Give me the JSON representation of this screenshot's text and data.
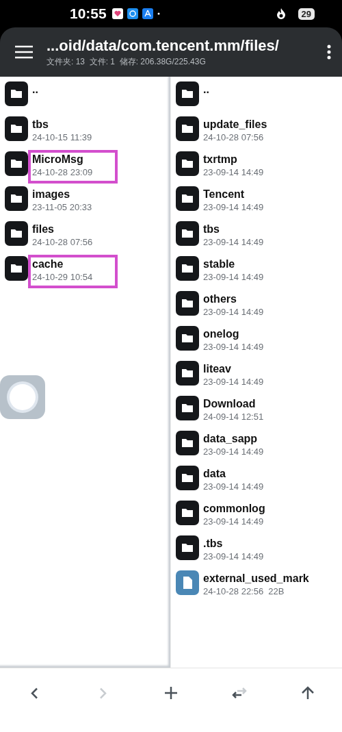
{
  "status_bar": {
    "time": "10:55",
    "battery": "29"
  },
  "header": {
    "path": "...oid/data/com.tencent.mm/files/",
    "info": "文件夹: 13  文件: 1  储存: 206.38G/225.43G"
  },
  "left_panel": {
    "items": [
      {
        "kind": "folder",
        "name": "..",
        "highlighted": false
      },
      {
        "kind": "folder",
        "name": "tbs",
        "date": "24-10-15 11:39",
        "highlighted": false
      },
      {
        "kind": "folder",
        "name": "MicroMsg",
        "date": "24-10-28 23:09",
        "highlighted": true
      },
      {
        "kind": "folder",
        "name": "images",
        "date": "23-11-05 20:33",
        "highlighted": false
      },
      {
        "kind": "folder",
        "name": "files",
        "date": "24-10-28 07:56",
        "highlighted": false
      },
      {
        "kind": "folder",
        "name": "cache",
        "date": "24-10-29 10:54",
        "highlighted": true
      }
    ]
  },
  "right_panel": {
    "items": [
      {
        "kind": "folder",
        "name": "..",
        "highlighted": false
      },
      {
        "kind": "folder",
        "name": "update_files",
        "date": "24-10-28 07:56",
        "highlighted": false
      },
      {
        "kind": "folder",
        "name": "txrtmp",
        "date": "23-09-14 14:49",
        "highlighted": false
      },
      {
        "kind": "folder",
        "name": "Tencent",
        "date": "23-09-14 14:49",
        "highlighted": false
      },
      {
        "kind": "folder",
        "name": "tbs",
        "date": "23-09-14 14:49",
        "highlighted": false
      },
      {
        "kind": "folder",
        "name": "stable",
        "date": "23-09-14 14:49",
        "highlighted": false
      },
      {
        "kind": "folder",
        "name": "others",
        "date": "23-09-14 14:49",
        "highlighted": false
      },
      {
        "kind": "folder",
        "name": "onelog",
        "date": "23-09-14 14:49",
        "highlighted": false
      },
      {
        "kind": "folder",
        "name": "liteav",
        "date": "23-09-14 14:49",
        "highlighted": false
      },
      {
        "kind": "folder",
        "name": "Download",
        "date": "24-09-14 12:51",
        "highlighted": false
      },
      {
        "kind": "folder",
        "name": "data_sapp",
        "date": "23-09-14 14:49",
        "highlighted": false
      },
      {
        "kind": "folder",
        "name": "data",
        "date": "23-09-14 14:49",
        "highlighted": false
      },
      {
        "kind": "folder",
        "name": "commonlog",
        "date": "23-09-14 14:49",
        "highlighted": false
      },
      {
        "kind": "folder",
        "name": ".tbs",
        "date": "23-09-14 14:49",
        "highlighted": false
      },
      {
        "kind": "file",
        "name": "external_used_mark",
        "date": "24-10-28 22:56",
        "size": "22B",
        "highlighted": false
      }
    ]
  },
  "bottom_bar": {
    "buttons": [
      {
        "kind": "back",
        "disabled": false
      },
      {
        "kind": "forward",
        "disabled": true
      },
      {
        "kind": "add",
        "disabled": false
      },
      {
        "kind": "swap",
        "disabled": false
      },
      {
        "kind": "up",
        "disabled": false
      }
    ]
  }
}
